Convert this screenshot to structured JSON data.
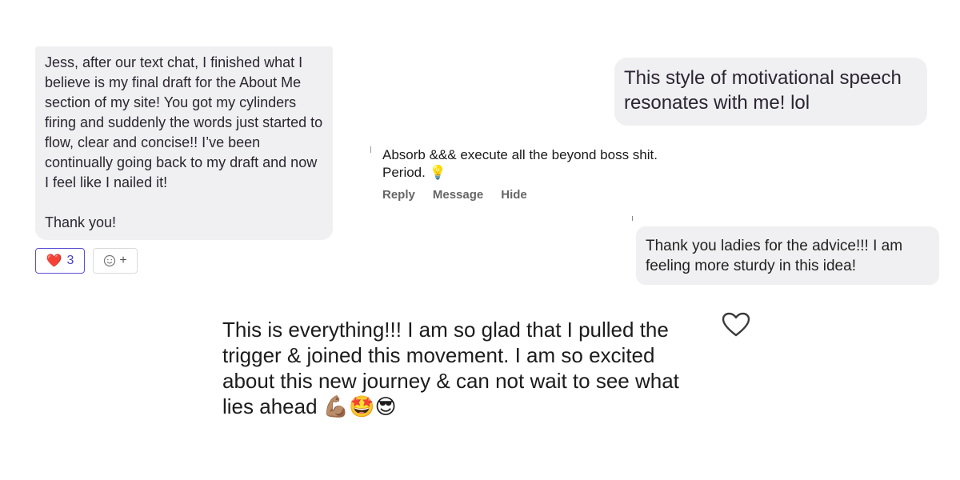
{
  "message_one": {
    "text": "Jess, after our text chat, I finished what I believe is my final draft for the About Me section of my site! You got my cylinders firing and suddenly the words just started to flow, clear and concise!! I’ve been continually going back to my draft and now I feel like I nailed it!\n\nThank you!",
    "reactions": {
      "heart_emoji": "❤️",
      "heart_count": "3",
      "add_reaction_icon": "smile-plus-icon",
      "add_symbol": "+"
    }
  },
  "message_two": {
    "text": "This style of motivational speech resonates with me! lol"
  },
  "comment": {
    "text": "Absorb &&& execute all the beyond boss shit. Period. 💡",
    "actions": {
      "reply": "Reply",
      "message": "Message",
      "hide": "Hide"
    }
  },
  "message_three": {
    "text": "Thank you ladies for the advice!!! I am feeling more sturdy in this idea!"
  },
  "post": {
    "text": "This is everything!!! I am so glad that I pulled the trigger & joined this movement. I am so excited about this new journey & can not wait to see what lies ahead 💪🏽🤩😎",
    "like_icon": "heart-outline-icon"
  },
  "colors": {
    "bubble_bg": "#f0eff1",
    "reaction_accent": "#5b4fd6"
  }
}
